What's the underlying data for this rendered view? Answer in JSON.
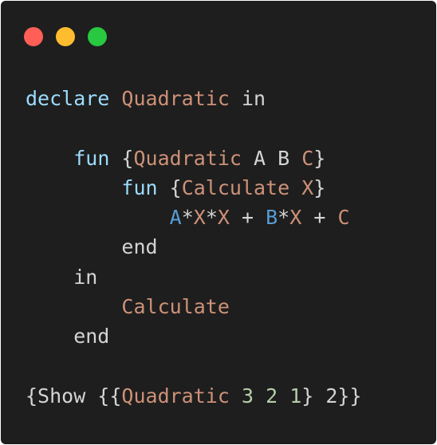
{
  "window": {
    "controls": [
      {
        "name": "close",
        "color": "#ff5f57"
      },
      {
        "name": "minimize",
        "color": "#febc2e"
      },
      {
        "name": "maximize",
        "color": "#28c840"
      }
    ]
  },
  "theme": {
    "background": "#1e1e1e",
    "default": "#d4d4d4",
    "keyword": "#9cdcfe",
    "identifier": "#ce9178",
    "variable": "#569cd6",
    "number": "#b5cea8"
  },
  "code_lines": [
    [
      {
        "t": "declare",
        "c": "keyword"
      },
      {
        "t": " ",
        "c": "default"
      },
      {
        "t": "Quadratic",
        "c": "identifier"
      },
      {
        "t": " in",
        "c": "default"
      }
    ],
    [],
    [
      {
        "t": "    ",
        "c": "default"
      },
      {
        "t": "fun",
        "c": "keyword"
      },
      {
        "t": " {",
        "c": "default"
      },
      {
        "t": "Quadratic",
        "c": "identifier"
      },
      {
        "t": " A B ",
        "c": "default"
      },
      {
        "t": "C",
        "c": "identifier"
      },
      {
        "t": "}",
        "c": "default"
      }
    ],
    [
      {
        "t": "        ",
        "c": "default"
      },
      {
        "t": "fun",
        "c": "keyword"
      },
      {
        "t": " {",
        "c": "default"
      },
      {
        "t": "Calculate",
        "c": "identifier"
      },
      {
        "t": " ",
        "c": "default"
      },
      {
        "t": "X",
        "c": "identifier"
      },
      {
        "t": "}",
        "c": "default"
      }
    ],
    [
      {
        "t": "            ",
        "c": "default"
      },
      {
        "t": "A",
        "c": "variable"
      },
      {
        "t": "*",
        "c": "default"
      },
      {
        "t": "X",
        "c": "identifier"
      },
      {
        "t": "*",
        "c": "default"
      },
      {
        "t": "X",
        "c": "identifier"
      },
      {
        "t": " + ",
        "c": "default"
      },
      {
        "t": "B",
        "c": "variable"
      },
      {
        "t": "*",
        "c": "default"
      },
      {
        "t": "X",
        "c": "identifier"
      },
      {
        "t": " + ",
        "c": "default"
      },
      {
        "t": "C",
        "c": "identifier"
      }
    ],
    [
      {
        "t": "        end",
        "c": "default"
      }
    ],
    [
      {
        "t": "    in",
        "c": "default"
      }
    ],
    [
      {
        "t": "        ",
        "c": "default"
      },
      {
        "t": "Calculate",
        "c": "identifier"
      }
    ],
    [
      {
        "t": "    end",
        "c": "default"
      }
    ],
    [],
    [
      {
        "t": "{Show {{",
        "c": "default"
      },
      {
        "t": "Quadratic",
        "c": "identifier"
      },
      {
        "t": " ",
        "c": "default"
      },
      {
        "t": "3",
        "c": "number"
      },
      {
        "t": " ",
        "c": "default"
      },
      {
        "t": "2",
        "c": "number"
      },
      {
        "t": " ",
        "c": "default"
      },
      {
        "t": "1",
        "c": "number"
      },
      {
        "t": "} 2}}",
        "c": "default"
      }
    ]
  ]
}
